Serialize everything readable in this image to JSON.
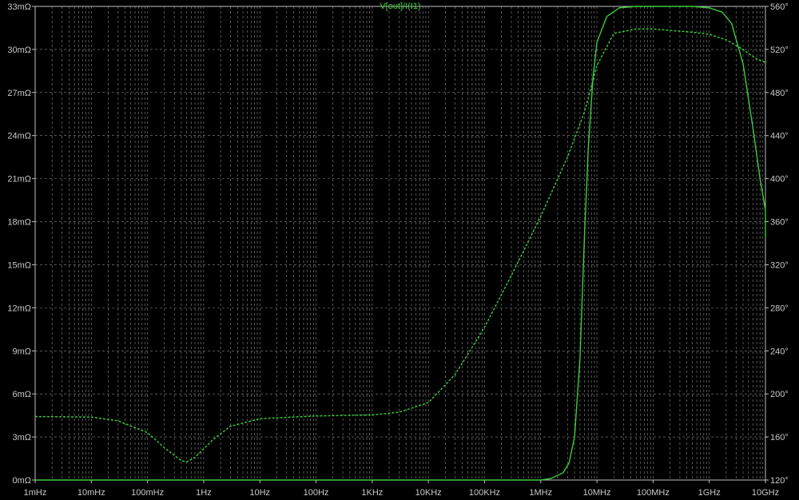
{
  "chart_data": {
    "type": "line",
    "title": "V[out]/I(I1)",
    "x_scale": "log",
    "xlim": [
      "1mHz",
      "10GHz"
    ],
    "x_ticks": [
      "1mHz",
      "10mHz",
      "100mHz",
      "1Hz",
      "10Hz",
      "100Hz",
      "1KHz",
      "10KHz",
      "100KHz",
      "1MHz",
      "10MHz",
      "100MHz",
      "1GHz",
      "10GHz"
    ],
    "y_left": {
      "unit": "mΩ",
      "ylim": [
        0,
        33
      ],
      "ticks": [
        "0mΩ",
        "3mΩ",
        "6mΩ",
        "9mΩ",
        "12mΩ",
        "15mΩ",
        "18mΩ",
        "21mΩ",
        "24mΩ",
        "27mΩ",
        "30mΩ",
        "33mΩ"
      ]
    },
    "y_right": {
      "unit": "°",
      "ylim": [
        120,
        560
      ],
      "ticks": [
        "120°",
        "160°",
        "200°",
        "240°",
        "280°",
        "320°",
        "360°",
        "400°",
        "440°",
        "480°",
        "520°",
        "560°"
      ]
    },
    "grid": true,
    "color": "#3ccc3c",
    "background": "#000000",
    "series": [
      {
        "style": "solid",
        "axis": "left",
        "points": [
          {
            "x": 0.001,
            "y": 0.0
          },
          {
            "x": 1000000,
            "y": 0.0
          },
          {
            "x": 1500000,
            "y": 0.1
          },
          {
            "x": 2500000,
            "y": 0.5
          },
          {
            "x": 3200000,
            "y": 1.2
          },
          {
            "x": 4000000,
            "y": 3.0
          },
          {
            "x": 5000000,
            "y": 8.5
          },
          {
            "x": 6000000,
            "y": 17.0
          },
          {
            "x": 7000000,
            "y": 23.0
          },
          {
            "x": 8500000,
            "y": 28.0
          },
          {
            "x": 10000000,
            "y": 30.5
          },
          {
            "x": 15000000,
            "y": 32.3
          },
          {
            "x": 25000000,
            "y": 32.9
          },
          {
            "x": 50000000,
            "y": 33.0
          },
          {
            "x": 100000000,
            "y": 33.0
          },
          {
            "x": 500000000,
            "y": 33.0
          },
          {
            "x": 1000000000,
            "y": 32.9
          },
          {
            "x": 1700000000,
            "y": 32.6
          },
          {
            "x": 2500000000,
            "y": 31.8
          },
          {
            "x": 4000000000,
            "y": 29.0
          },
          {
            "x": 6000000000,
            "y": 24.5
          },
          {
            "x": 8000000000,
            "y": 21.0
          },
          {
            "x": 10000000000,
            "y": 18.8
          },
          {
            "x": 13000000000,
            "y": 16.9
          }
        ]
      },
      {
        "style": "dashed",
        "axis": "right",
        "points": [
          {
            "x": 0.001,
            "y": 179
          },
          {
            "x": 0.01,
            "y": 178.5
          },
          {
            "x": 0.03,
            "y": 175
          },
          {
            "x": 0.1,
            "y": 164
          },
          {
            "x": 0.2,
            "y": 150
          },
          {
            "x": 0.4,
            "y": 138
          },
          {
            "x": 0.5,
            "y": 137
          },
          {
            "x": 0.7,
            "y": 141
          },
          {
            "x": 1.5,
            "y": 158
          },
          {
            "x": 3,
            "y": 170
          },
          {
            "x": 10,
            "y": 177
          },
          {
            "x": 100,
            "y": 179.5
          },
          {
            "x": 1000,
            "y": 180.5
          },
          {
            "x": 3000,
            "y": 183
          },
          {
            "x": 10000,
            "y": 192
          },
          {
            "x": 30000,
            "y": 218
          },
          {
            "x": 100000,
            "y": 262
          },
          {
            "x": 300000,
            "y": 310
          },
          {
            "x": 1000000,
            "y": 365
          },
          {
            "x": 3000000,
            "y": 420
          },
          {
            "x": 6000000,
            "y": 462
          },
          {
            "x": 10000000,
            "y": 505
          },
          {
            "x": 20000000,
            "y": 535
          },
          {
            "x": 50000000,
            "y": 539
          },
          {
            "x": 100000000,
            "y": 539
          },
          {
            "x": 500000000,
            "y": 536
          },
          {
            "x": 1000000000,
            "y": 534
          },
          {
            "x": 2000000000,
            "y": 529
          },
          {
            "x": 4000000000,
            "y": 520
          },
          {
            "x": 7000000000,
            "y": 511
          },
          {
            "x": 13000000000,
            "y": 508
          }
        ]
      }
    ]
  }
}
